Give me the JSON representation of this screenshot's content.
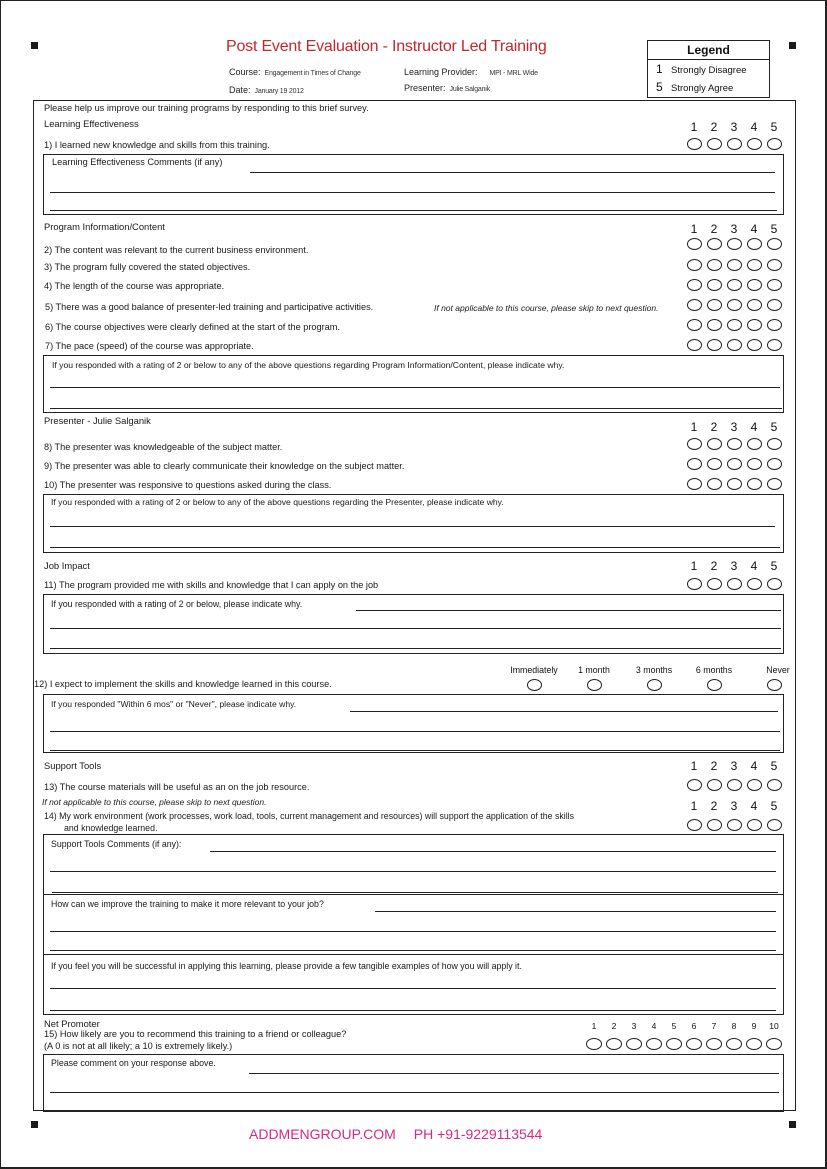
{
  "header": {
    "title": "Post Event Evaluation - Instructor Led Training",
    "course_label": "Course:",
    "course_value": "Engagement in Times of Change",
    "provider_label": "Learning Provider:",
    "provider_value": "MPI - MRL Wide",
    "date_label": "Date:",
    "date_value": "January 19 2012",
    "presenter_label": "Presenter:",
    "presenter_value": "Julie Salganik"
  },
  "legend": {
    "title": "Legend",
    "items": [
      {
        "num": "1",
        "label": "Strongly Disagree"
      },
      {
        "num": "5",
        "label": "Strongly Agree"
      }
    ]
  },
  "intro": "Please help us improve our training programs by responding to this brief survey.",
  "scale5": [
    "1",
    "2",
    "3",
    "4",
    "5"
  ],
  "scale10": [
    "1",
    "2",
    "3",
    "4",
    "5",
    "6",
    "7",
    "8",
    "9",
    "10"
  ],
  "sections": {
    "learning": {
      "title": "Learning Effectiveness",
      "q1": "1) I learned new knowledge and skills from this training.",
      "comment": "Learning Effectiveness Comments (if any)"
    },
    "program": {
      "title": "Program Information/Content",
      "q2": "2) The content was relevant to the current business  environment.",
      "q3": "3) The program fully covered the stated objectives.",
      "q4": "4) The length of the course was appropriate.",
      "q5": "5) There was a good balance of presenter-led training and participative activities.",
      "q5_note": "If not applicable to this course, please skip to next question.",
      "q6": "6) The course objectives were clearly defined at the start of the program.",
      "q7": "7) The pace (speed) of the course was appropriate.",
      "comment": "If you responded with a rating of 2 or below to any of the above questions regarding Program Information/Content, please indicate why."
    },
    "presenter": {
      "title": "Presenter - Julie Salganik",
      "q8": "8) The presenter was knowledgeable of the subject matter.",
      "q9": "9) The presenter was able to clearly communicate their knowledge on the subject matter.",
      "q10": "10) The presenter was responsive to questions asked during the class.",
      "comment": "If you responded with a rating of 2 or below to any of the above questions regarding the Presenter, please indicate why."
    },
    "job": {
      "title": "Job Impact",
      "q11": "11) The program provided me with skills and knowledge that I can apply on the job",
      "comment": "If you responded with a rating of 2 or below, please indicate why.",
      "q12": "12) I expect to implement the skills and knowledge learned in this course.",
      "q12_options": [
        "Immediately",
        "1 month",
        "3 months",
        "6 months",
        "Never"
      ],
      "q12_comment": "If you responded \"Within 6 mos\" or \"Never\", please indicate why."
    },
    "support": {
      "title": "Support Tools",
      "q13": "13) The course materials will be useful as an on the job resource.",
      "q13_note": "If not applicable to this course, please skip to next question.",
      "q14_line1": "14) My work environment (work processes, work load, tools, current management and resources) will support the application of the skills",
      "q14_line2": "and knowledge learned.",
      "comment": "Support Tools Comments (if any):",
      "improve": "How can we improve the training to make it more relevant to your job?",
      "apply": "If you feel you will be successful in applying this learning, please provide a few tangible examples of how you will apply it."
    },
    "net": {
      "title": "Net Promoter",
      "q15": "15) How likely are you to recommend this training to a friend or colleague?",
      "q15_note": "(A 0 is not at all likely; a 10 is extremely likely.)",
      "comment": "Please comment on your response above."
    }
  },
  "footer": {
    "website": "ADDMENGROUP.COM",
    "phone": "PH +91-9229113544"
  },
  "colors": {
    "title": "#c0282d",
    "footer": "#d42a86"
  }
}
